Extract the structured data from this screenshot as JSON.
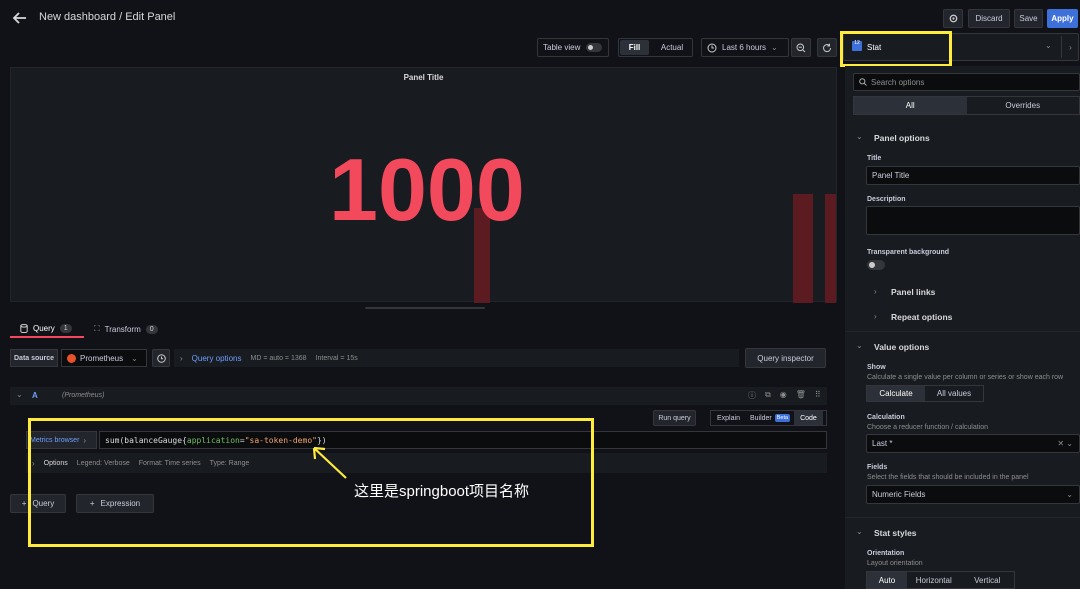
{
  "header": {
    "title": "New dashboard / Edit Panel",
    "discard": "Discard",
    "save": "Save",
    "apply": "Apply"
  },
  "toolbar": {
    "table_view": "Table view",
    "fill": "Fill",
    "actual": "Actual",
    "time_range": "Last 6 hours"
  },
  "viz_picker": {
    "name": "Stat"
  },
  "panel": {
    "title": "Panel Title",
    "value": "1000",
    "value_color": "#f2495c"
  },
  "query_tabs": {
    "query": "Query",
    "query_count": "1",
    "transform": "Transform",
    "transform_count": "0"
  },
  "datasource": {
    "label": "Data source",
    "name": "Prometheus",
    "query_options": "Query options",
    "md": "MD = auto = 1368",
    "interval": "Interval = 15s",
    "inspector": "Query inspector"
  },
  "query_a": {
    "ref": "A",
    "ds": "(Prometheus)",
    "run": "Run query",
    "explain": "Explain",
    "builder": "Builder",
    "beta": "Beta",
    "code": "Code",
    "metrics_browser": "Metrics browser",
    "expr_fn": "sum(balanceGauge{",
    "expr_key": "application",
    "expr_eq": "=",
    "expr_val": "\"sa-token-demo\"",
    "expr_end": "})",
    "options": "Options",
    "legend": "Legend: Verbose",
    "format": "Format: Time series",
    "type": "Type: Range"
  },
  "add": {
    "query": "Query",
    "expression": "Expression"
  },
  "annotation": {
    "text": "这里是springboot项目名称",
    "color": "#ffeb3b"
  },
  "options_pane": {
    "search_placeholder": "Search options",
    "tab_all": "All",
    "tab_overrides": "Overrides",
    "panel_options": "Panel options",
    "title_label": "Title",
    "title_value": "Panel Title",
    "description_label": "Description",
    "transparent_label": "Transparent background",
    "panel_links": "Panel links",
    "repeat_options": "Repeat options",
    "value_options": "Value options",
    "show_label": "Show",
    "show_desc": "Calculate a single value per column or series or show each row",
    "calculate": "Calculate",
    "all_values": "All values",
    "calc_label": "Calculation",
    "calc_desc": "Choose a reducer function / calculation",
    "calc_value": "Last *",
    "fields_label": "Fields",
    "fields_desc": "Select the fields that should be included in the panel",
    "fields_value": "Numeric Fields",
    "stat_styles": "Stat styles",
    "orient_label": "Orientation",
    "orient_desc": "Layout orientation",
    "auto": "Auto",
    "horizontal": "Horizontal",
    "vertical": "Vertical"
  }
}
